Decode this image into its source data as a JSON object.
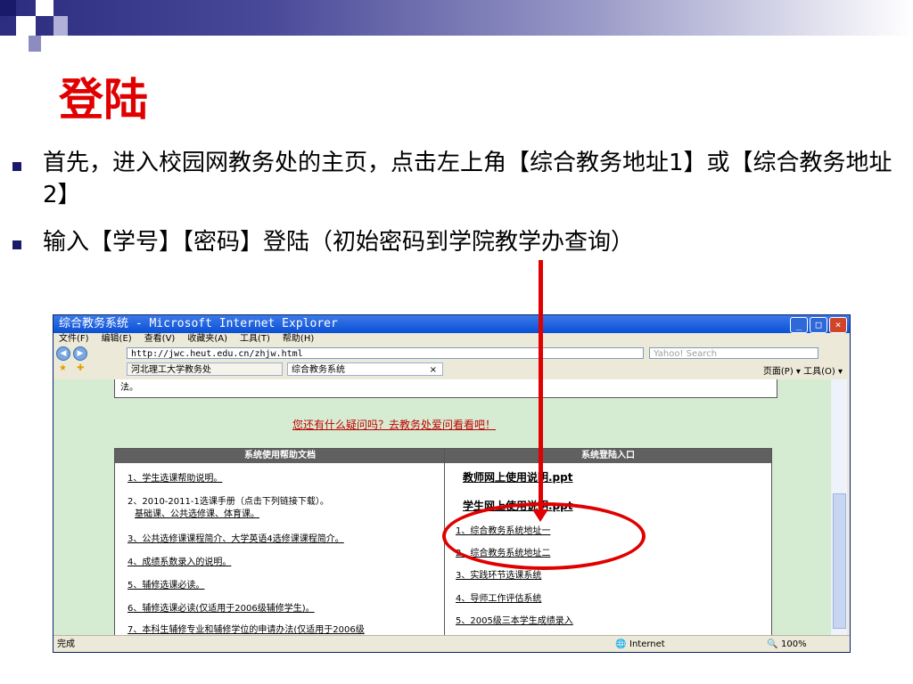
{
  "slide": {
    "title": "登陆",
    "bullets": [
      "首先，进入校园网教务处的主页，点击左上角【综合教务地址1】或【综合教务地址2】",
      "输入【学号】【密码】登陆（初始密码到学院教学办查询）"
    ]
  },
  "browser": {
    "title": "综合教务系统 - Microsoft Internet Explorer",
    "menu": [
      "文件(F)",
      "编辑(E)",
      "查看(V)",
      "收藏夹(A)",
      "工具(T)",
      "帮助(H)"
    ],
    "address": "http://jwc.heut.edu.cn/zhjw.html",
    "search_placeholder": "Yahoo! Search",
    "tabs": [
      "河北理工大学教务处",
      "综合教务系统"
    ],
    "tab_tools": "页面(P) ▾  工具(O) ▾",
    "status_left": "完成",
    "status_zone": "Internet",
    "zoom": "100%"
  },
  "page": {
    "top_text": "法。",
    "question": "您还有什么疑问吗？去教务处爱问看看吧！",
    "left_panel": {
      "heading": "系统使用帮助文档",
      "items": [
        "1、学生选课帮助说明。",
        "2、2010-2011-1选课手册（点击下列链接下载）。",
        "基础课、公共选修课、体育课。",
        "3、公共选修课课程简介、大学英语4选修课课程简介。",
        "4、成绩系数录入的说明。",
        "5、辅修选课必读。",
        "6、辅修选课必读(仅适用于2006级辅修学生)。",
        "7、本科生辅修专业和辅修学位的申请办法(仅适用于2006级"
      ]
    },
    "right_panel": {
      "heading": "系统登陆入口",
      "teacher_link": "教师网上使用说明.ppt",
      "student_link": "学生网上使用说明.ppt",
      "entries": [
        "1、综合教务系统地址一",
        "2、综合教务系统地址二",
        "3、实践环节选课系统",
        "4、导师工作评估系统",
        "5、2005级三本学生成绩录入"
      ]
    }
  },
  "colors": {
    "accent_red": "#e00000",
    "title_blue": "#0a4fd6",
    "content_green": "#d6ecd2"
  }
}
